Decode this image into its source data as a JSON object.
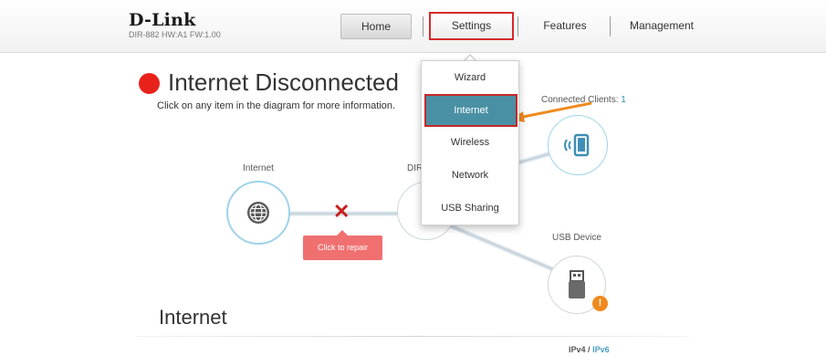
{
  "header": {
    "brand": "D-Link",
    "model_info": "DIR-882 HW:A1 FW:1.00",
    "nav": {
      "home": "Home",
      "settings": "Settings",
      "features": "Features",
      "management": "Management"
    }
  },
  "status": {
    "title": "Internet Disconnected",
    "subtitle": "Click on any item in the diagram for more information.",
    "color": "#e8221b"
  },
  "diagram": {
    "internet_label": "Internet",
    "router_label": "DIR",
    "clients_label": "Connected Clients:",
    "clients_count": "1",
    "usb_label": "USB Device",
    "repair_label": "Click to repair",
    "warning_symbol": "!"
  },
  "settings_menu": {
    "items": [
      "Wizard",
      "Internet",
      "Wireless",
      "Network",
      "USB Sharing"
    ],
    "selected": "Internet"
  },
  "section": {
    "title": "Internet",
    "ipv4": "IPv4",
    "separator": "/",
    "ipv6": "IPv6"
  },
  "colors": {
    "accent": "#4a90a4",
    "highlight": "#c62828",
    "link": "#4a9ec8",
    "warning": "#f08a1e"
  }
}
